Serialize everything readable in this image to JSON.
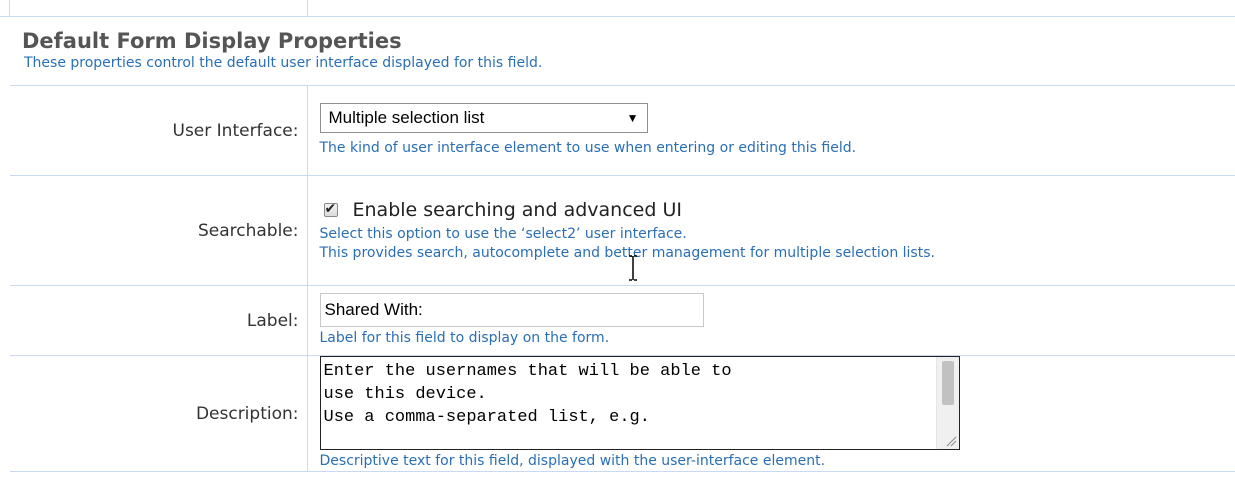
{
  "section": {
    "title": "Default Form Display Properties",
    "subtitle": "These properties control the default user interface displayed for this field."
  },
  "fields": {
    "user_interface": {
      "label": "User Interface:",
      "selected": "Multiple selection list",
      "help": "The kind of user interface element to use when entering or editing this field."
    },
    "searchable": {
      "label": "Searchable:",
      "checkbox_label": "Enable searching and advanced UI",
      "checked": true,
      "help_line1": "Select this option to use the ‘select2’ user interface.",
      "help_line2": "This provides search, autocomplete and better management for multiple selection lists."
    },
    "label": {
      "label": "Label:",
      "value": "Shared With:",
      "help": "Label for this field to display on the form."
    },
    "description": {
      "label": "Description:",
      "value": "Enter the usernames that will be able to\nuse this device.\nUse a comma-separated list, e.g.",
      "help": "Descriptive text for this field, displayed with the user-interface element."
    }
  },
  "icons": {
    "select_arrow": "dropdown-arrow-icon",
    "checkmark": "checkmark-icon",
    "resize": "resize-grip-icon",
    "cursor": "text-cursor-icon"
  },
  "colors": {
    "help_text": "#2a6fb5",
    "border": "#c9daf0",
    "title": "#555555"
  }
}
